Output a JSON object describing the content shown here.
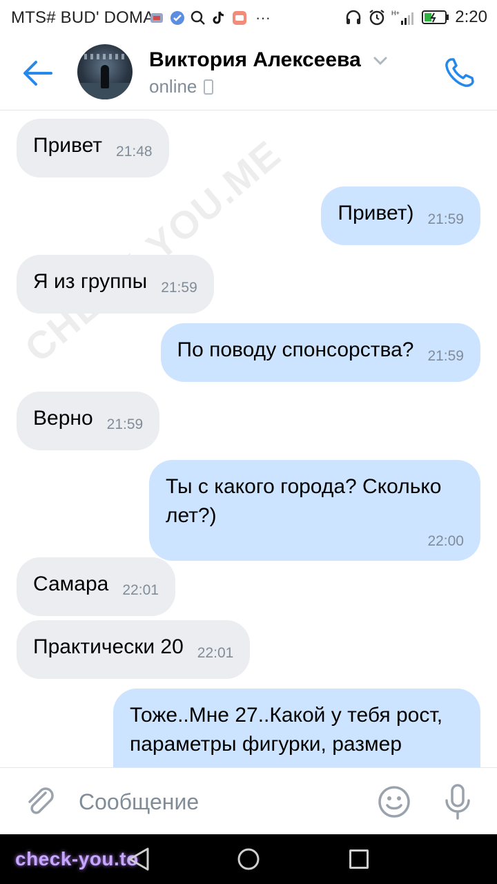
{
  "status_bar": {
    "carrier": "MTS# BUD' DOMA",
    "time": "2:20",
    "more": "···"
  },
  "header": {
    "name": "Виктория Алексеева",
    "status": "online"
  },
  "watermark": "CHECK-YOU.ME",
  "messages": [
    {
      "dir": "in",
      "text": "Привет",
      "time": "21:48"
    },
    {
      "dir": "out",
      "text": "Привет)",
      "time": "21:59"
    },
    {
      "dir": "in",
      "text": "Я из группы",
      "time": "21:59"
    },
    {
      "dir": "out",
      "text": "По поводу спонсорства?",
      "time": "21:59"
    },
    {
      "dir": "in",
      "text": "Верно",
      "time": "21:59"
    },
    {
      "dir": "out",
      "text": "Ты с какого города? Сколько лет?)",
      "time": "22:00"
    },
    {
      "dir": "in",
      "text": "Самара",
      "time": "22:01"
    },
    {
      "dir": "in",
      "text": "Практически 20",
      "time": "22:01"
    },
    {
      "dir": "out",
      "text": "Тоже..Мне 27..Какой у тебя рост, параметры фигурки, размер",
      "time": ""
    }
  ],
  "composer": {
    "placeholder": "Сообщение"
  },
  "nav_bar": {
    "brand": "check-you.to"
  },
  "colors": {
    "accent": "#2688eb",
    "incoming_bubble": "#ebedf0",
    "outgoing_bubble": "#cce4ff",
    "secondary_text": "#818c99"
  },
  "icons": [
    "back-arrow-icon",
    "chevron-down-icon",
    "phone-icon",
    "paperclip-icon",
    "smile-icon",
    "microphone-icon",
    "headphones-icon",
    "alarm-icon",
    "battery-icon",
    "signal-icon"
  ]
}
